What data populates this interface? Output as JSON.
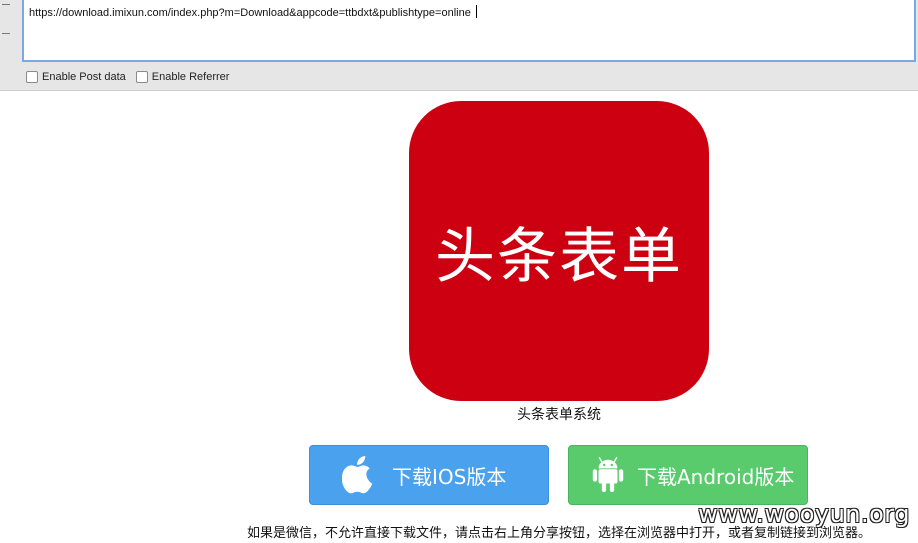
{
  "toolbar": {
    "url": "https://download.imixun.com/index.php?m=Download&appcode=ttbdxt&publishtype=online",
    "post_label": "Enable Post data",
    "referrer_label": "Enable Referrer"
  },
  "app": {
    "icon_text": "头条表单",
    "icon_color": "#cd0012",
    "name": "头条表单系统"
  },
  "buttons": {
    "ios_label": "下载IOS版本",
    "ios_color": "#4aa1ee",
    "ios_icon": "apple-icon",
    "android_label": "下载Android版本",
    "android_color": "#5acb6d",
    "android_icon": "android-icon"
  },
  "notice": "如果是微信，不允许直接下载文件，请点击右上角分享按钮，选择在浏览器中打开，或者复制链接到浏览器。",
  "watermark": "www.wooyun.org"
}
